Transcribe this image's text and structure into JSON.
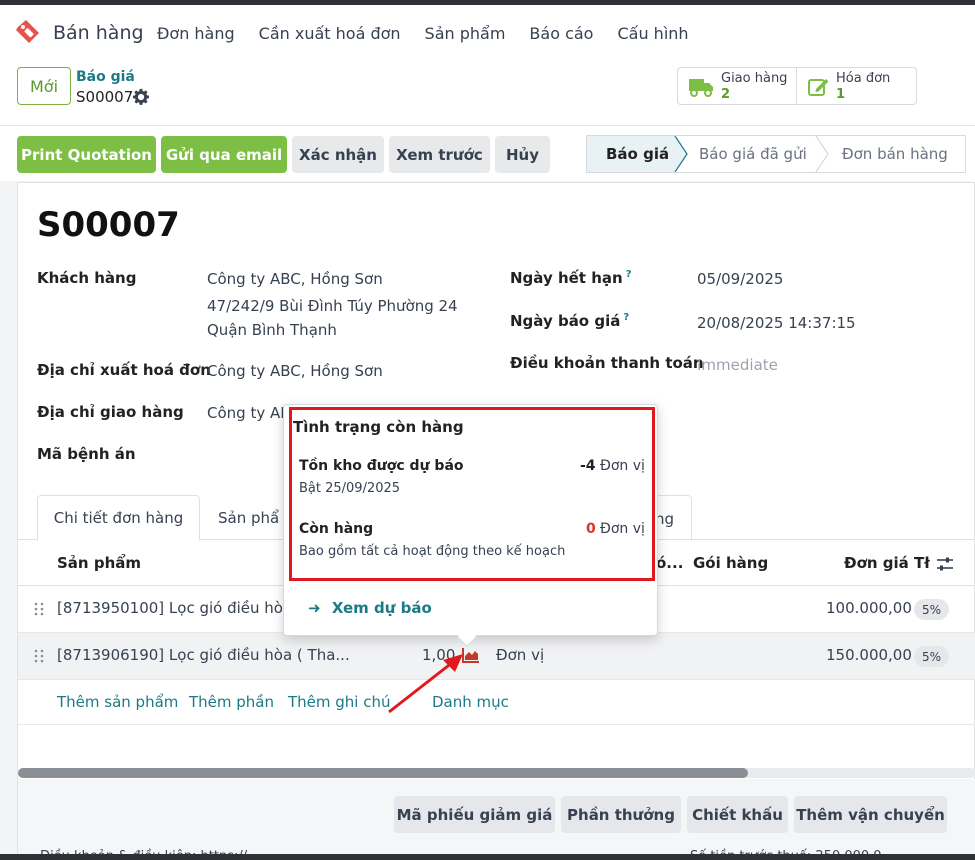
{
  "app": {
    "name": "Bán hàng",
    "menu": [
      "Đơn hàng",
      "Cần xuất hoá đơn",
      "Sản phẩm",
      "Báo cáo",
      "Cấu hình"
    ],
    "logo_icon": "sale-tag-icon"
  },
  "control_panel": {
    "new_label": "Mới",
    "breadcrumb_parent": "Báo giá",
    "breadcrumb_current": "S00007",
    "smart_buttons": [
      {
        "label": "Giao hàng",
        "value": "2",
        "icon": "truck-icon"
      },
      {
        "label": "Hóa đơn",
        "value": "1",
        "icon": "pencil-square-icon"
      }
    ]
  },
  "actions": {
    "print": "Print Quotation",
    "email": "Gửi qua email",
    "confirm": "Xác nhận",
    "preview": "Xem trước",
    "cancel": "Hủy"
  },
  "statusbar": [
    "Báo giá",
    "Báo giá đã gửi",
    "Đơn bán hàng"
  ],
  "form": {
    "reference": "S00007",
    "customer_label": "Khách hàng",
    "customer_name": "Công ty ABC, Hồng Sơn",
    "customer_addr1": "47/242/9 Bùi Đình Túy Phường 24",
    "customer_addr2": "Quận Bình Thạnh",
    "invoice_addr_label": "Địa chỉ xuất hoá đơn",
    "invoice_addr": "Công ty ABC, Hồng Sơn",
    "delivery_addr_label": "Địa chỉ giao hàng",
    "delivery_addr": "Công ty AB",
    "record_label": "Mã bệnh án",
    "expiry_label": "Ngày hết hạn",
    "expiry_value": "05/09/2025",
    "quote_date_label": "Ngày báo giá",
    "quote_date_value": "20/08/2025 14:37:15",
    "terms_label": "Điều khoản thanh toán",
    "terms_value": "Immediate",
    "help_mark": "?"
  },
  "tabs": {
    "order_lines": "Chi tiết đơn hàng",
    "products_partial": "Sản phẩ",
    "hidden_partial": "ng"
  },
  "table": {
    "headers": {
      "product": "Sản phẩm",
      "hidden_partial": "ó...",
      "packaging": "Gói hàng",
      "unit_price": "Đơn giá",
      "tax_partial": "Tł"
    },
    "rows": [
      {
        "product": "[8713950100] Lọc gió điều hòa",
        "qty": "",
        "uom": "",
        "price": "100.000,00",
        "tax": "5%"
      },
      {
        "product": "[8713906190] Lọc gió điều hòa ( Tha...",
        "qty": "1,00",
        "uom": "Đơn vị",
        "price": "150.000,00",
        "tax": "5%"
      }
    ],
    "add_links": [
      "Thêm sản phẩm",
      "Thêm phần",
      "Thêm ghi chú",
      "Danh mục"
    ]
  },
  "footer_buttons": [
    "Mã phiếu giảm giá",
    "Phần thưởng",
    "Chiết khấu",
    "Thêm vận chuyển"
  ],
  "footer_cut": {
    "left": "Điều khoản & điều kiện: https://...",
    "right": "Số tiền trước thuế:  250.000,0"
  },
  "popover": {
    "title": "Tình trạng còn hàng",
    "forecast_label": "Tồn kho được dự báo",
    "forecast_value": "-4",
    "forecast_unit": "Đơn vị",
    "forecast_sub": "Bật 25/09/2025",
    "onhand_label": "Còn hàng",
    "onhand_value": "0",
    "onhand_unit": "Đơn vị",
    "onhand_sub": "Bao gồm tất cả hoạt động theo kế hoạch",
    "link": "Xem dự báo",
    "link_icon": "arrow-right-icon"
  },
  "colors": {
    "primary_green": "#7cbf44",
    "teal": "#1c7a86",
    "highlight_red": "#e0191f",
    "negative_red": "#d9362b"
  }
}
